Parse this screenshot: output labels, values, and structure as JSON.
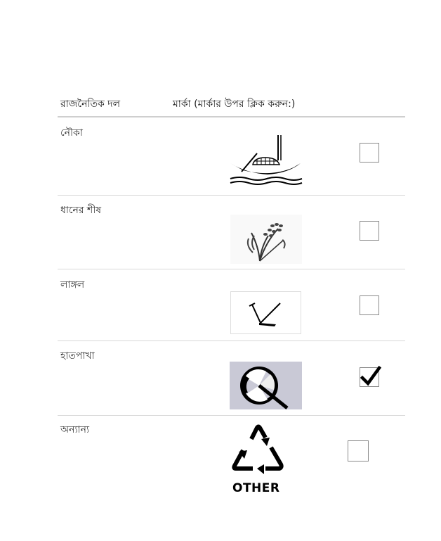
{
  "table": {
    "header": {
      "party_label": "রাজনৈতিক দল",
      "symbol_label": "মার্কা (মার্কার উপর ক্লিক করুন:)"
    },
    "rows": [
      {
        "label": "নৌকা",
        "symbol_icon": "boat-icon",
        "checked": false
      },
      {
        "label": "ধানের শীষ",
        "symbol_icon": "paddy-sheaf-icon",
        "checked": false
      },
      {
        "label": "লাঙ্গল",
        "symbol_icon": "plough-icon",
        "checked": false
      },
      {
        "label": "হাতপাখা",
        "symbol_icon": "hand-fan-icon",
        "checked": true
      },
      {
        "label": "অন্যান্য",
        "symbol_icon": "recycle-other-icon",
        "symbol_text": "OTHER",
        "checked": false
      }
    ]
  }
}
